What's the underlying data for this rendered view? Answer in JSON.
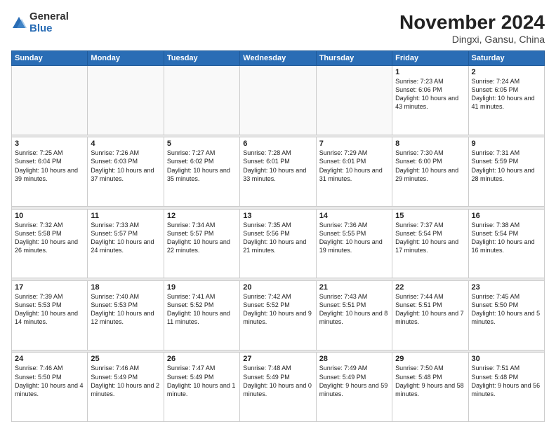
{
  "logo": {
    "general": "General",
    "blue": "Blue"
  },
  "header": {
    "month": "November 2024",
    "location": "Dingxi, Gansu, China"
  },
  "weekdays": [
    "Sunday",
    "Monday",
    "Tuesday",
    "Wednesday",
    "Thursday",
    "Friday",
    "Saturday"
  ],
  "weeks": [
    [
      {
        "day": "",
        "info": ""
      },
      {
        "day": "",
        "info": ""
      },
      {
        "day": "",
        "info": ""
      },
      {
        "day": "",
        "info": ""
      },
      {
        "day": "",
        "info": ""
      },
      {
        "day": "1",
        "info": "Sunrise: 7:23 AM\nSunset: 6:06 PM\nDaylight: 10 hours\nand 43 minutes."
      },
      {
        "day": "2",
        "info": "Sunrise: 7:24 AM\nSunset: 6:05 PM\nDaylight: 10 hours\nand 41 minutes."
      }
    ],
    [
      {
        "day": "3",
        "info": "Sunrise: 7:25 AM\nSunset: 6:04 PM\nDaylight: 10 hours\nand 39 minutes."
      },
      {
        "day": "4",
        "info": "Sunrise: 7:26 AM\nSunset: 6:03 PM\nDaylight: 10 hours\nand 37 minutes."
      },
      {
        "day": "5",
        "info": "Sunrise: 7:27 AM\nSunset: 6:02 PM\nDaylight: 10 hours\nand 35 minutes."
      },
      {
        "day": "6",
        "info": "Sunrise: 7:28 AM\nSunset: 6:01 PM\nDaylight: 10 hours\nand 33 minutes."
      },
      {
        "day": "7",
        "info": "Sunrise: 7:29 AM\nSunset: 6:01 PM\nDaylight: 10 hours\nand 31 minutes."
      },
      {
        "day": "8",
        "info": "Sunrise: 7:30 AM\nSunset: 6:00 PM\nDaylight: 10 hours\nand 29 minutes."
      },
      {
        "day": "9",
        "info": "Sunrise: 7:31 AM\nSunset: 5:59 PM\nDaylight: 10 hours\nand 28 minutes."
      }
    ],
    [
      {
        "day": "10",
        "info": "Sunrise: 7:32 AM\nSunset: 5:58 PM\nDaylight: 10 hours\nand 26 minutes."
      },
      {
        "day": "11",
        "info": "Sunrise: 7:33 AM\nSunset: 5:57 PM\nDaylight: 10 hours\nand 24 minutes."
      },
      {
        "day": "12",
        "info": "Sunrise: 7:34 AM\nSunset: 5:57 PM\nDaylight: 10 hours\nand 22 minutes."
      },
      {
        "day": "13",
        "info": "Sunrise: 7:35 AM\nSunset: 5:56 PM\nDaylight: 10 hours\nand 21 minutes."
      },
      {
        "day": "14",
        "info": "Sunrise: 7:36 AM\nSunset: 5:55 PM\nDaylight: 10 hours\nand 19 minutes."
      },
      {
        "day": "15",
        "info": "Sunrise: 7:37 AM\nSunset: 5:54 PM\nDaylight: 10 hours\nand 17 minutes."
      },
      {
        "day": "16",
        "info": "Sunrise: 7:38 AM\nSunset: 5:54 PM\nDaylight: 10 hours\nand 16 minutes."
      }
    ],
    [
      {
        "day": "17",
        "info": "Sunrise: 7:39 AM\nSunset: 5:53 PM\nDaylight: 10 hours\nand 14 minutes."
      },
      {
        "day": "18",
        "info": "Sunrise: 7:40 AM\nSunset: 5:53 PM\nDaylight: 10 hours\nand 12 minutes."
      },
      {
        "day": "19",
        "info": "Sunrise: 7:41 AM\nSunset: 5:52 PM\nDaylight: 10 hours\nand 11 minutes."
      },
      {
        "day": "20",
        "info": "Sunrise: 7:42 AM\nSunset: 5:52 PM\nDaylight: 10 hours\nand 9 minutes."
      },
      {
        "day": "21",
        "info": "Sunrise: 7:43 AM\nSunset: 5:51 PM\nDaylight: 10 hours\nand 8 minutes."
      },
      {
        "day": "22",
        "info": "Sunrise: 7:44 AM\nSunset: 5:51 PM\nDaylight: 10 hours\nand 7 minutes."
      },
      {
        "day": "23",
        "info": "Sunrise: 7:45 AM\nSunset: 5:50 PM\nDaylight: 10 hours\nand 5 minutes."
      }
    ],
    [
      {
        "day": "24",
        "info": "Sunrise: 7:46 AM\nSunset: 5:50 PM\nDaylight: 10 hours\nand 4 minutes."
      },
      {
        "day": "25",
        "info": "Sunrise: 7:46 AM\nSunset: 5:49 PM\nDaylight: 10 hours\nand 2 minutes."
      },
      {
        "day": "26",
        "info": "Sunrise: 7:47 AM\nSunset: 5:49 PM\nDaylight: 10 hours\nand 1 minute."
      },
      {
        "day": "27",
        "info": "Sunrise: 7:48 AM\nSunset: 5:49 PM\nDaylight: 10 hours\nand 0 minutes."
      },
      {
        "day": "28",
        "info": "Sunrise: 7:49 AM\nSunset: 5:49 PM\nDaylight: 9 hours\nand 59 minutes."
      },
      {
        "day": "29",
        "info": "Sunrise: 7:50 AM\nSunset: 5:48 PM\nDaylight: 9 hours\nand 58 minutes."
      },
      {
        "day": "30",
        "info": "Sunrise: 7:51 AM\nSunset: 5:48 PM\nDaylight: 9 hours\nand 56 minutes."
      }
    ]
  ]
}
